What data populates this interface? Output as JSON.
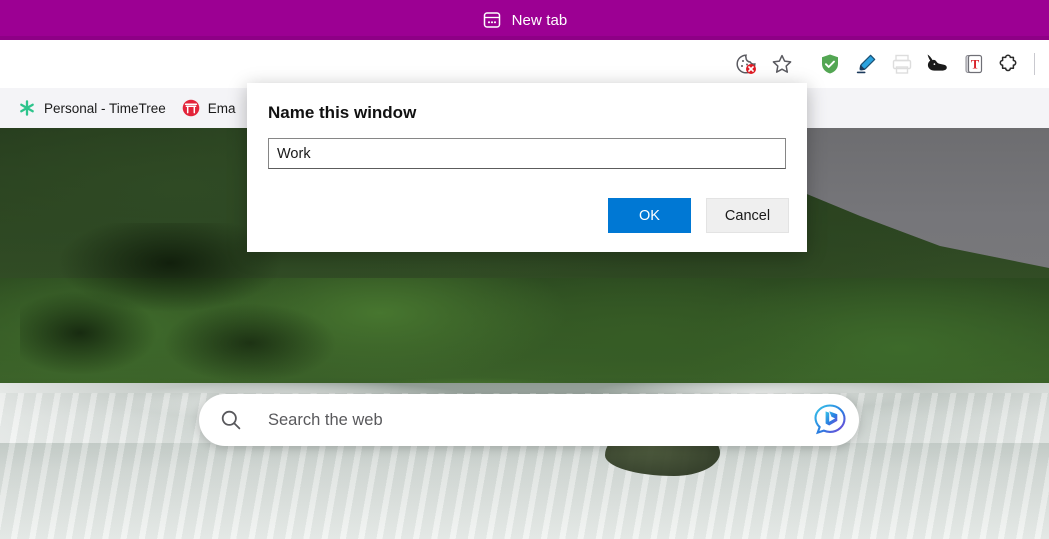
{
  "titlebar": {
    "tab_label": "New tab",
    "icon": "tab-group-icon",
    "color": "#9c0093"
  },
  "toolbar": {
    "icons": [
      {
        "name": "cookie-blocked-icon",
        "label": "Cookies blocked"
      },
      {
        "name": "favorite-star-icon",
        "label": "Add to favorites"
      },
      {
        "name": "shield-check-icon",
        "label": "Adblock shield"
      },
      {
        "name": "highlighter-pen-icon",
        "label": "Highlighter"
      },
      {
        "name": "printer-icon",
        "label": "Print"
      },
      {
        "name": "rabbit-icon",
        "label": "Rabbit extension"
      },
      {
        "name": "todoist-t-icon",
        "label": "T extension"
      },
      {
        "name": "puzzle-piece-icon",
        "label": "Extensions"
      }
    ]
  },
  "bookmarks": {
    "items": [
      {
        "label": "Personal - TimeTree",
        "icon": "timetree-icon"
      },
      {
        "label": "Ema",
        "icon": "torii-gate-icon"
      }
    ]
  },
  "search": {
    "placeholder": "Search the web",
    "value": "",
    "search_icon": "magnifier-icon",
    "chat_icon": "bing-chat-icon"
  },
  "dialog": {
    "title": "Name this window",
    "input_value": "Work",
    "input_placeholder": "",
    "ok_label": "OK",
    "cancel_label": "Cancel",
    "accent_color": "#0078d4"
  }
}
